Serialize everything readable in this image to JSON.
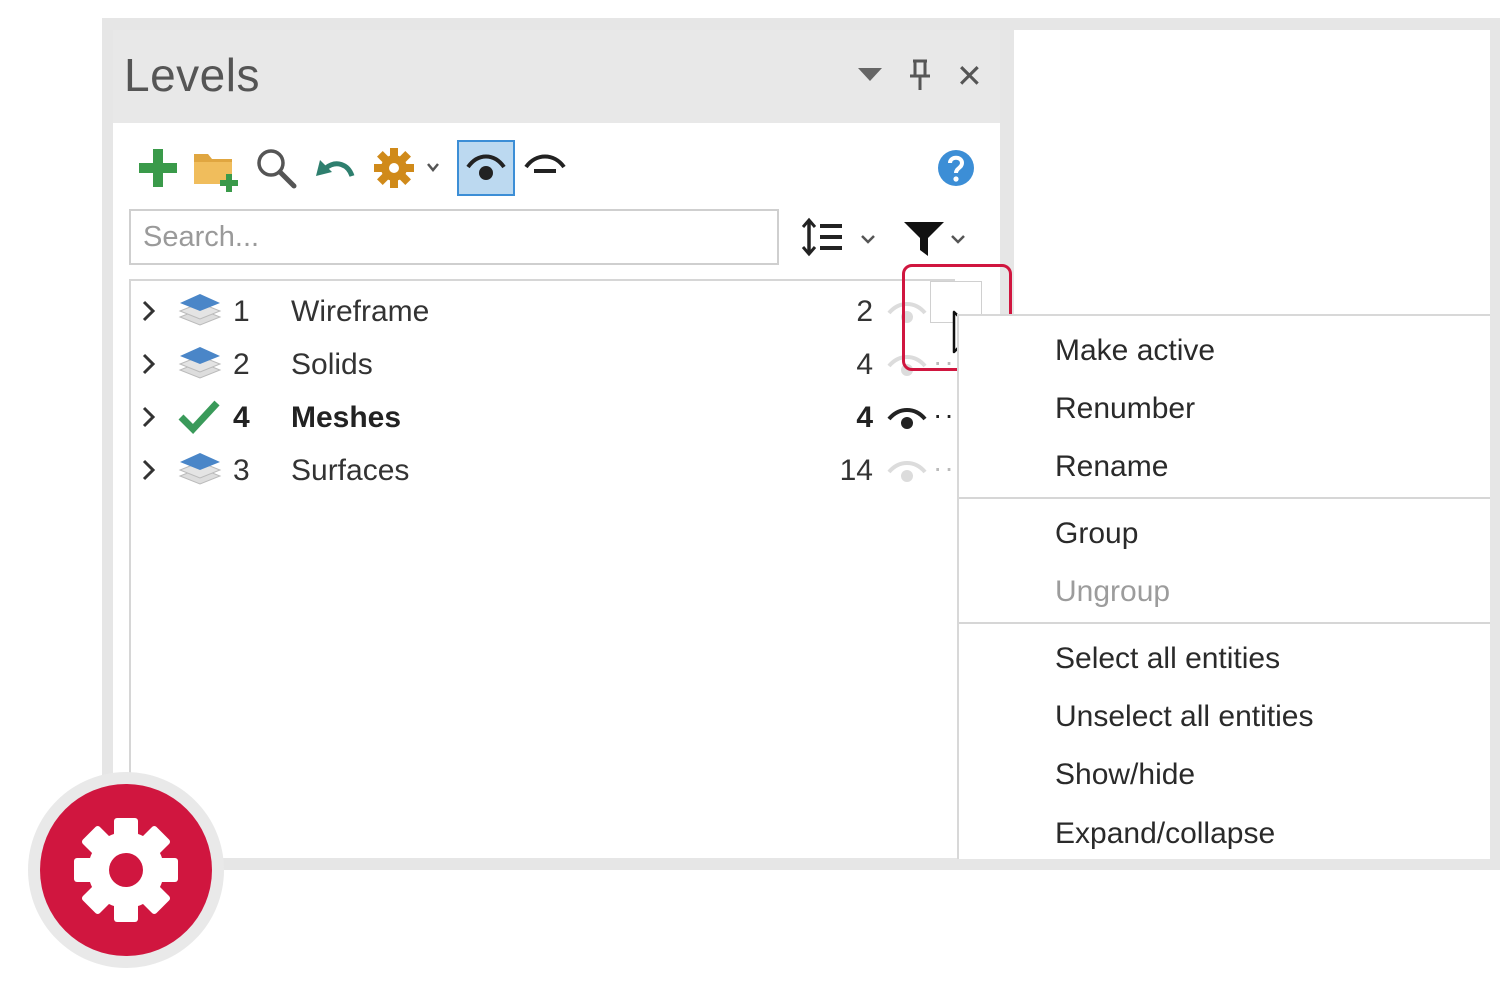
{
  "panel": {
    "title": "Levels",
    "header_icons": [
      "dropdown-triangle-icon",
      "pin-icon",
      "close-icon"
    ],
    "close_glyph": "✕"
  },
  "toolbar": {
    "icons": [
      "add-level-icon",
      "add-folder-icon",
      "search-icon",
      "undo-icon",
      "settings-icon",
      "eye-visible-icon",
      "eye-hidden-icon",
      "help-icon"
    ]
  },
  "search": {
    "placeholder": "Search..."
  },
  "sort_filter": {
    "icons": [
      "sort-list-icon",
      "filter-icon"
    ]
  },
  "levels": [
    {
      "number": "1",
      "name": "Wireframe",
      "count": "2",
      "active": false,
      "visible": false,
      "dots": "···"
    },
    {
      "number": "2",
      "name": "Solids",
      "count": "4",
      "active": false,
      "visible": false,
      "dots": "··"
    },
    {
      "number": "4",
      "name": "Meshes",
      "count": "4",
      "active": true,
      "visible": true,
      "dots": "··"
    },
    {
      "number": "3",
      "name": "Surfaces",
      "count": "14",
      "active": false,
      "visible": false,
      "dots": "··"
    }
  ],
  "context_menu": {
    "items": [
      {
        "label": "Make active",
        "enabled": true
      },
      {
        "label": "Renumber",
        "enabled": true
      },
      {
        "label": "Rename",
        "enabled": true
      },
      {
        "label": "Group",
        "enabled": true
      },
      {
        "label": "Ungroup",
        "enabled": false
      },
      {
        "label": "Select all entities",
        "enabled": true
      },
      {
        "label": "Unselect all entities",
        "enabled": true
      },
      {
        "label": "Show/hide",
        "enabled": true
      },
      {
        "label": "Expand/collapse",
        "enabled": true
      }
    ]
  },
  "colors": {
    "accent": "#d0163f",
    "add_green": "#3a9a4a",
    "folder_orange": "#e0a640",
    "settings_orange": "#d08a1a",
    "help_blue": "#3c8ed6",
    "layer_blue": "#4a86c8",
    "check_green": "#3a9a5a",
    "active_button_bg": "#bcd9f0"
  },
  "badge": {
    "icon": "gear-icon"
  }
}
